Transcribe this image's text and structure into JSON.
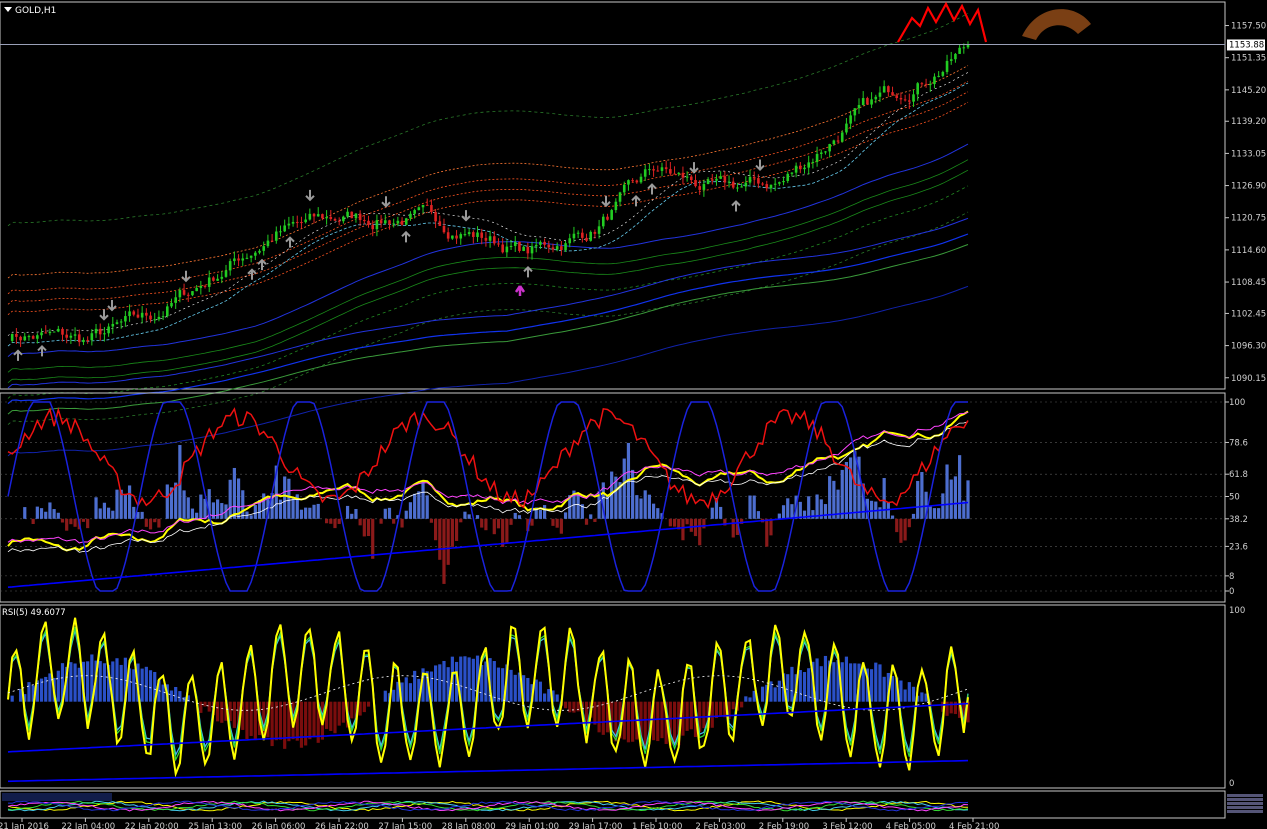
{
  "window": {
    "symbol_label": "GOLD,H1",
    "current_price": "1153.88",
    "rsi_label": "RSI(5) 49.6077"
  },
  "axes": {
    "price_ticks": [
      "1157.50",
      "1151.35",
      "1145.20",
      "1139.20",
      "1133.05",
      "1126.90",
      "1120.75",
      "1114.60",
      "1108.45",
      "1102.45",
      "1096.30",
      "1090.15"
    ],
    "panel2_ticks": [
      "100",
      "78.6",
      "61.8",
      "50",
      "38.2",
      "23.6",
      "8",
      "0"
    ],
    "rsi_ticks": [
      "100",
      "0"
    ],
    "time_labels": [
      "21 Jan 2016",
      "22 Jan 04:00",
      "22 Jan 20:00",
      "25 Jan 13:00",
      "26 Jan 06:00",
      "26 Jan 22:00",
      "27 Jan 15:00",
      "28 Jan 08:00",
      "29 Jan 01:00",
      "29 Jan 17:00",
      "1 Feb 10:00",
      "2 Feb 03:00",
      "2 Feb 19:00",
      "3 Feb 12:00",
      "4 Feb 05:00",
      "4 Feb 21:00"
    ]
  },
  "colors": {
    "background": "#000000",
    "bull_candle": "#22cc22",
    "bear_candle": "#dd2222",
    "signal_arrow": "#ff0000",
    "rsi_fast": "#ffff00",
    "histogram_up": "#4d6ecf",
    "histogram_down": "#8b1a1a",
    "baseline": "#0000ff"
  },
  "chart_data": {
    "type": "candlestick",
    "symbol": "GOLD",
    "timeframe": "H1",
    "x": [
      "21 Jan 2016",
      "22 Jan 04:00",
      "22 Jan 20:00",
      "25 Jan 13:00",
      "26 Jan 06:00",
      "26 Jan 22:00",
      "27 Jan 15:00",
      "28 Jan 08:00",
      "29 Jan 01:00",
      "29 Jan 17:00",
      "1 Feb 10:00",
      "2 Feb 03:00",
      "2 Feb 19:00",
      "3 Feb 12:00",
      "4 Feb 05:00",
      "4 Feb 21:00"
    ],
    "close_at_labels": [
      1098.5,
      1097.0,
      1101.0,
      1109.5,
      1118.0,
      1120.5,
      1121.0,
      1118.5,
      1114.0,
      1118.5,
      1129.5,
      1125.5,
      1127.5,
      1138.5,
      1146.5,
      1154.0
    ],
    "last_price": 1153.88,
    "ylim": [
      1088.0,
      1162.0
    ],
    "sub_panel": {
      "levels": [
        100,
        78.6,
        61.8,
        50,
        38.2,
        23.6,
        8,
        0
      ],
      "ylim": [
        0,
        100
      ]
    },
    "rsi": {
      "period": 5,
      "last_value": 49.6077,
      "ylim": [
        0,
        100
      ]
    }
  }
}
